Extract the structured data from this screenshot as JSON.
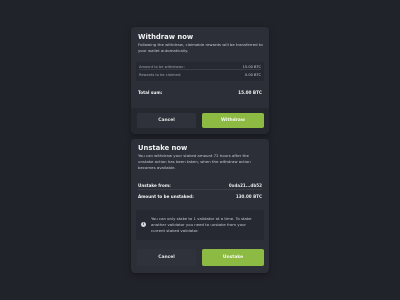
{
  "withdraw": {
    "title": "Withdraw now",
    "description": "Following the withdraw, claimable rewards will be transferred to your wallet automatically.",
    "rows": [
      {
        "label": "Amount to be withdrawn:",
        "value": "15.00 BTC"
      },
      {
        "label": "Rewards to be claimed:",
        "value": "0.00 BTC"
      }
    ],
    "total_label": "Total sum:",
    "total_value": "15.00 BTC",
    "cancel_label": "Cancel",
    "confirm_label": "Withdraw"
  },
  "unstake": {
    "title": "Unstake now",
    "description": "You can withdraw your staked amount 72 hours after the unstake action has been taken, when the withdraw action becomes available.",
    "rows": [
      {
        "label": "Unstake from:",
        "value": "0xda21...db52"
      },
      {
        "label": "Amount to be unstaked:",
        "value": "130.00 BTC"
      }
    ],
    "info_icon": "info-icon",
    "info_text": "You can only stake to 1 validator at a time. To stake another validator you need to unstake from your current staked validator.",
    "cancel_label": "Cancel",
    "confirm_label": "Unstake"
  },
  "colors": {
    "background": "#21232a",
    "card": "#2c2f37",
    "accent": "#8dba43"
  }
}
